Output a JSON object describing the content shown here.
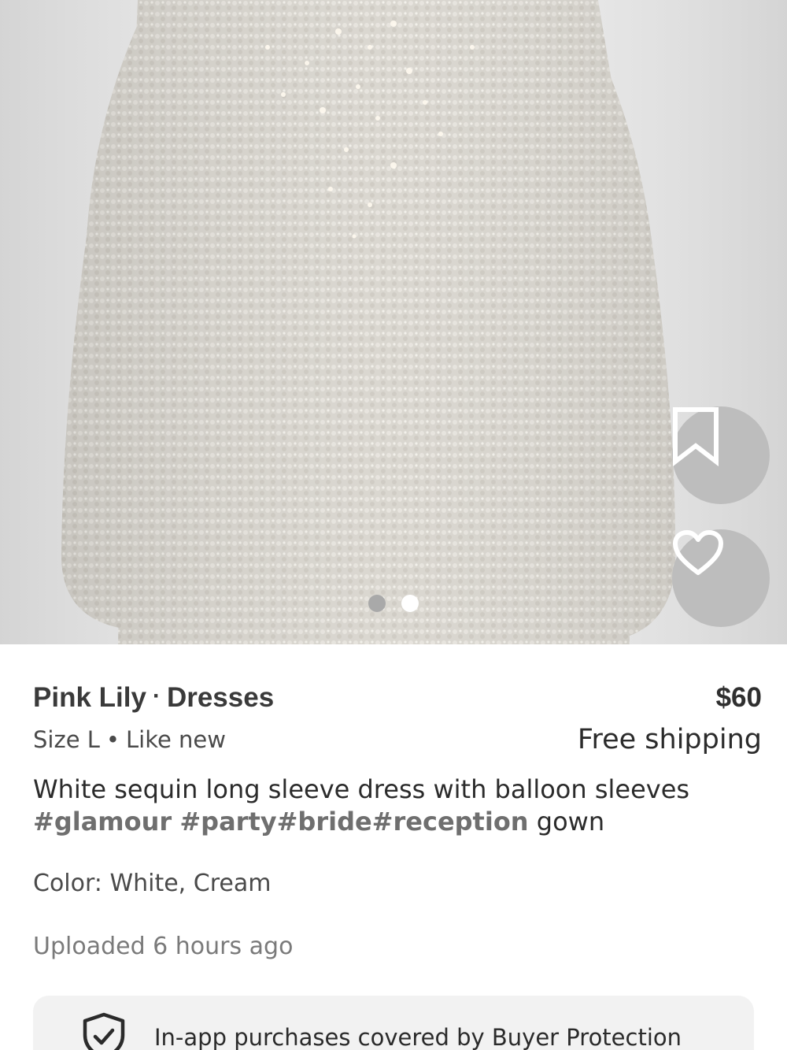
{
  "product": {
    "image_alt": "White sequin long sleeve dress",
    "brand": "Pink Lily",
    "category": "Dresses",
    "title_separator": "·",
    "price": "$60",
    "size": "Size L",
    "meta_separator": "•",
    "condition": "Like new",
    "shipping": "Free shipping",
    "description_text": "White sequin long sleeve dress with balloon sleeves ",
    "hashtags": [
      "#glamour",
      " ",
      "#party",
      "#bride",
      "#reception"
    ],
    "description_tail": " gown",
    "color": "Color: White, Cream",
    "uploaded": "Uploaded 6 hours ago"
  },
  "carousel": {
    "page_count": 2,
    "active_index": 1
  },
  "actions": {
    "bookmark_icon": "bookmark-icon",
    "like_icon": "heart-icon"
  },
  "protection": {
    "icon": "shield-check-icon",
    "text": "In-app purchases covered by Buyer Protection"
  },
  "colors": {
    "image_bg": "#eeeeee",
    "action_button_bg": "#bdbdbd",
    "hashtag": "#6f6f6f",
    "protection_bg": "#f2f2f2"
  }
}
